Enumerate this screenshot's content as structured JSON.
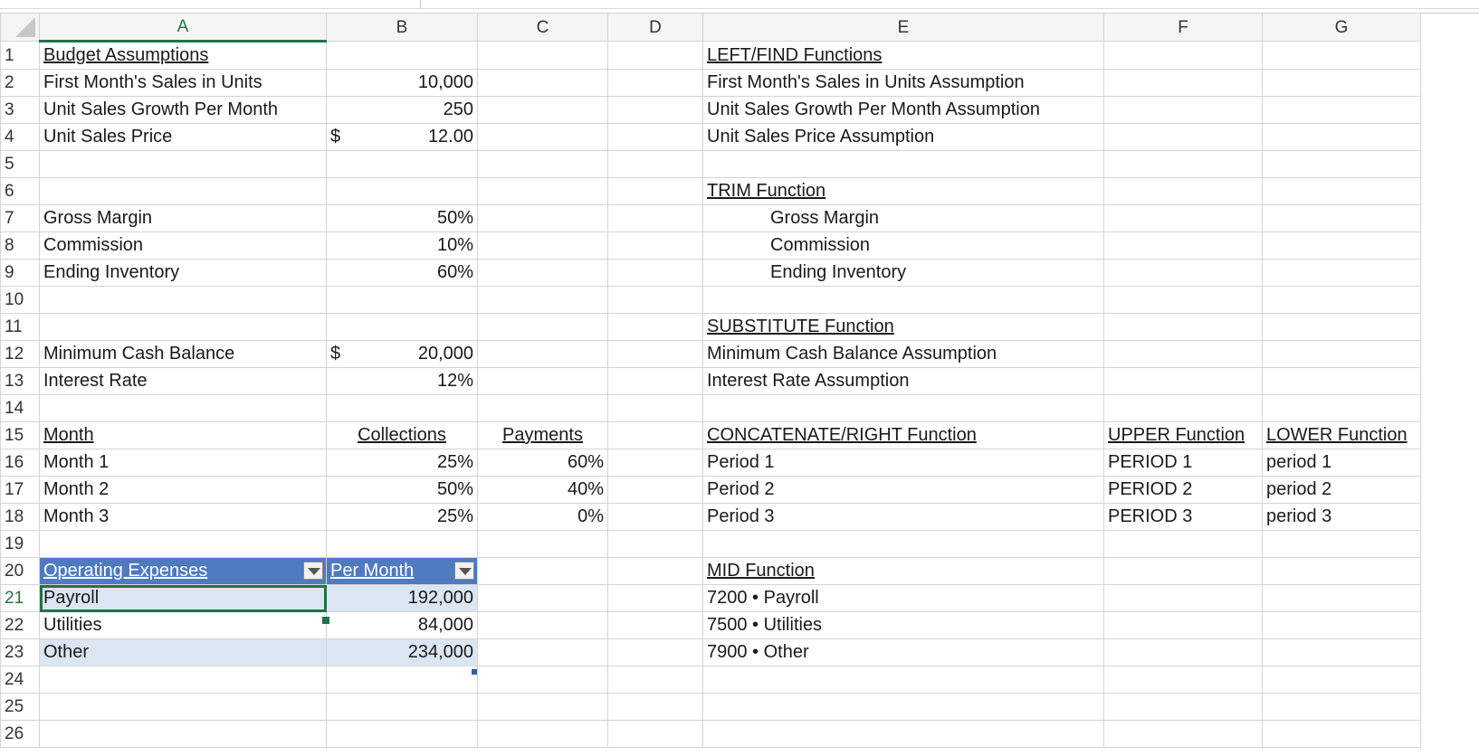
{
  "columns": [
    "A",
    "B",
    "C",
    "D",
    "E",
    "F",
    "G"
  ],
  "rows": {
    "r1": {
      "n": "1",
      "a": "Budget Assumptions",
      "e": "LEFT/FIND Functions"
    },
    "r2": {
      "n": "2",
      "a": "First Month's Sales in Units",
      "b": "10,000",
      "e": "First Month's Sales in Units Assumption"
    },
    "r3": {
      "n": "3",
      "a": "Unit Sales Growth Per Month",
      "b": "250",
      "e": "Unit Sales Growth Per Month Assumption"
    },
    "r4": {
      "n": "4",
      "a": "Unit Sales Price",
      "b_cur": "$",
      "b": "12.00",
      "e": "Unit Sales Price Assumption"
    },
    "r5": {
      "n": "5"
    },
    "r6": {
      "n": "6",
      "e": "TRIM Function"
    },
    "r7": {
      "n": "7",
      "a": "Gross Margin",
      "b": "50%",
      "e": "Gross Margin"
    },
    "r8": {
      "n": "8",
      "a": "Commission",
      "b": "10%",
      "e": "Commission"
    },
    "r9": {
      "n": "9",
      "a": "Ending Inventory",
      "b": "60%",
      "e": "Ending Inventory"
    },
    "r10": {
      "n": "10"
    },
    "r11": {
      "n": "11",
      "e": "SUBSTITUTE Function"
    },
    "r12": {
      "n": "12",
      "a": "Minimum Cash Balance",
      "b_cur": "$",
      "b": "20,000",
      "e": "Minimum Cash Balance Assumption"
    },
    "r13": {
      "n": "13",
      "a": "Interest Rate",
      "b": "12%",
      "e": "Interest Rate Assumption"
    },
    "r14": {
      "n": "14"
    },
    "r15": {
      "n": "15",
      "a": "Month",
      "b": "Collections",
      "c": "Payments",
      "e": "CONCATENATE/RIGHT Function",
      "f": "UPPER Function",
      "g": "LOWER Function"
    },
    "r16": {
      "n": "16",
      "a": "Month 1",
      "b": "25%",
      "c": "60%",
      "e": "Period 1",
      "f": "PERIOD 1",
      "g": "period 1"
    },
    "r17": {
      "n": "17",
      "a": "Month 2",
      "b": "50%",
      "c": "40%",
      "e": "Period 2",
      "f": "PERIOD 2",
      "g": "period 2"
    },
    "r18": {
      "n": "18",
      "a": "Month 3",
      "b": "25%",
      "c": "0%",
      "e": "Period 3",
      "f": "PERIOD 3",
      "g": "period 3"
    },
    "r19": {
      "n": "19"
    },
    "r20": {
      "n": "20",
      "a": "Operating Expenses",
      "b": "Per Month",
      "e": "MID Function"
    },
    "r21": {
      "n": "21",
      "a": "Payroll",
      "b": "192,000",
      "e": "7200 • Payroll"
    },
    "r22": {
      "n": "22",
      "a": "Utilities",
      "b": "84,000",
      "e": "7500 • Utilities"
    },
    "r23": {
      "n": "23",
      "a": "Other",
      "b": "234,000",
      "e": "7900 • Other"
    },
    "r24": {
      "n": "24"
    },
    "r25": {
      "n": "25"
    },
    "r26": {
      "n": "26"
    }
  },
  "selected_cell": "A21",
  "colors": {
    "accent_green": "#217346",
    "table_header": "#4f7ac0",
    "table_band": "#dce6f2"
  }
}
